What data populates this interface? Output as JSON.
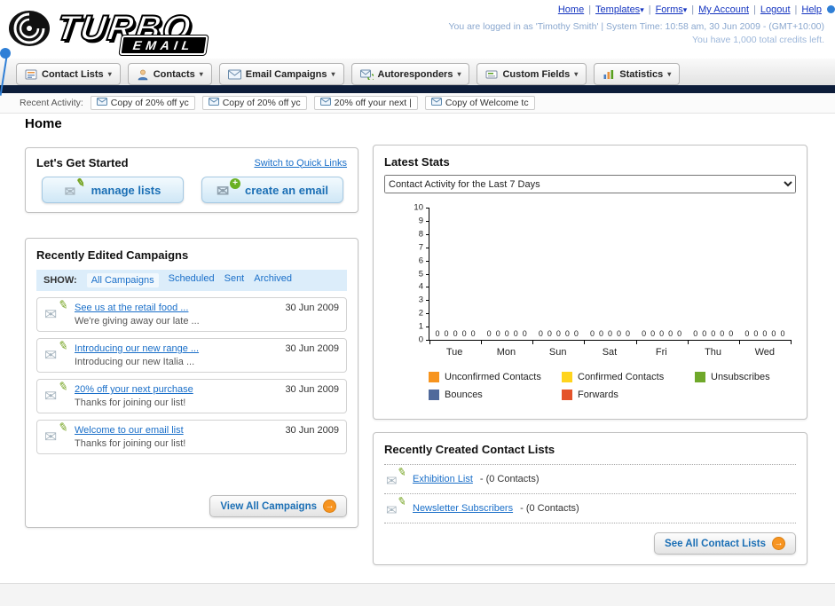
{
  "header": {
    "logo_text": "TURBO",
    "logo_sub": "EMAIL",
    "nav_links": [
      {
        "label": "Home",
        "caret": false
      },
      {
        "label": "Templates",
        "caret": true
      },
      {
        "label": "Forms",
        "caret": true
      },
      {
        "label": "My Account",
        "caret": false
      },
      {
        "label": "Logout",
        "caret": false
      },
      {
        "label": "Help",
        "caret": false
      }
    ],
    "login_info": "You are logged in as 'Timothy Smith' | System Time: 10:58 am, 30 Jun 2009 - (GMT+10:00)",
    "credits_info": "You have 1,000 total credits left."
  },
  "main_nav": {
    "tabs": [
      {
        "label": "Contact Lists",
        "icon": "contact-lists-icon"
      },
      {
        "label": "Contacts",
        "icon": "contacts-icon"
      },
      {
        "label": "Email Campaigns",
        "icon": "email-campaigns-icon"
      },
      {
        "label": "Autoresponders",
        "icon": "autoresponders-icon"
      },
      {
        "label": "Custom Fields",
        "icon": "custom-fields-icon"
      },
      {
        "label": "Statistics",
        "icon": "statistics-icon"
      }
    ]
  },
  "recent_activity": {
    "label": "Recent Activity:",
    "items": [
      "Copy of 20% off yc",
      "Copy of 20% off yc",
      "20% off your next |",
      "Copy of Welcome tc"
    ]
  },
  "page_title": "Home",
  "get_started": {
    "title": "Let's Get Started",
    "switch_link": "Switch to Quick Links",
    "buttons": [
      {
        "label": "manage lists"
      },
      {
        "label": "create an email"
      }
    ]
  },
  "campaigns": {
    "title": "Recently Edited Campaigns",
    "show_label": "SHOW:",
    "filters": [
      "All Campaigns",
      "Scheduled",
      "Sent",
      "Archived"
    ],
    "active_filter": "All Campaigns",
    "items": [
      {
        "title": "See us at the retail food ...",
        "subtitle": "We're giving away our late ...",
        "date": "30 Jun 2009"
      },
      {
        "title": "Introducing our new range ...",
        "subtitle": "Introducing our new Italia ...",
        "date": "30 Jun 2009"
      },
      {
        "title": "20% off your next purchase",
        "subtitle": "Thanks for joining our list!",
        "date": "30 Jun 2009"
      },
      {
        "title": "Welcome to our email list",
        "subtitle": "Thanks for joining our list!",
        "date": "30 Jun 2009"
      }
    ],
    "view_all_label": "View All Campaigns"
  },
  "latest_stats": {
    "title": "Latest Stats",
    "dropdown_value": "Contact Activity for the Last 7 Days"
  },
  "chart_data": {
    "type": "bar",
    "title": "Contact Activity for the Last 7 Days",
    "categories": [
      "Tue",
      "Mon",
      "Sun",
      "Sat",
      "Fri",
      "Thu",
      "Wed"
    ],
    "series": [
      {
        "name": "Unconfirmed Contacts",
        "color": "#f7941e",
        "values": [
          0,
          0,
          0,
          0,
          0,
          0,
          0
        ]
      },
      {
        "name": "Confirmed Contacts",
        "color": "#ffd41e",
        "values": [
          0,
          0,
          0,
          0,
          0,
          0,
          0
        ]
      },
      {
        "name": "Unsubscribes",
        "color": "#6fa82a",
        "values": [
          0,
          0,
          0,
          0,
          0,
          0,
          0
        ]
      },
      {
        "name": "Bounces",
        "color": "#50699b",
        "values": [
          0,
          0,
          0,
          0,
          0,
          0,
          0
        ]
      },
      {
        "name": "Forwards",
        "color": "#e4532a",
        "values": [
          0,
          0,
          0,
          0,
          0,
          0,
          0
        ]
      }
    ],
    "xlabel": "",
    "ylabel": "",
    "ylim": [
      0,
      10
    ],
    "yticks": [
      0,
      1,
      2,
      3,
      4,
      5,
      6,
      7,
      8,
      9,
      10
    ],
    "grid": false,
    "legend_position": "bottom"
  },
  "contact_lists": {
    "title": "Recently Created Contact Lists",
    "items": [
      {
        "name": "Exhibition List",
        "suffix": "- (0 Contacts)"
      },
      {
        "name": "Newsletter Subscribers",
        "suffix": "- (0 Contacts)"
      }
    ],
    "see_all_label": "See All Contact Lists"
  }
}
